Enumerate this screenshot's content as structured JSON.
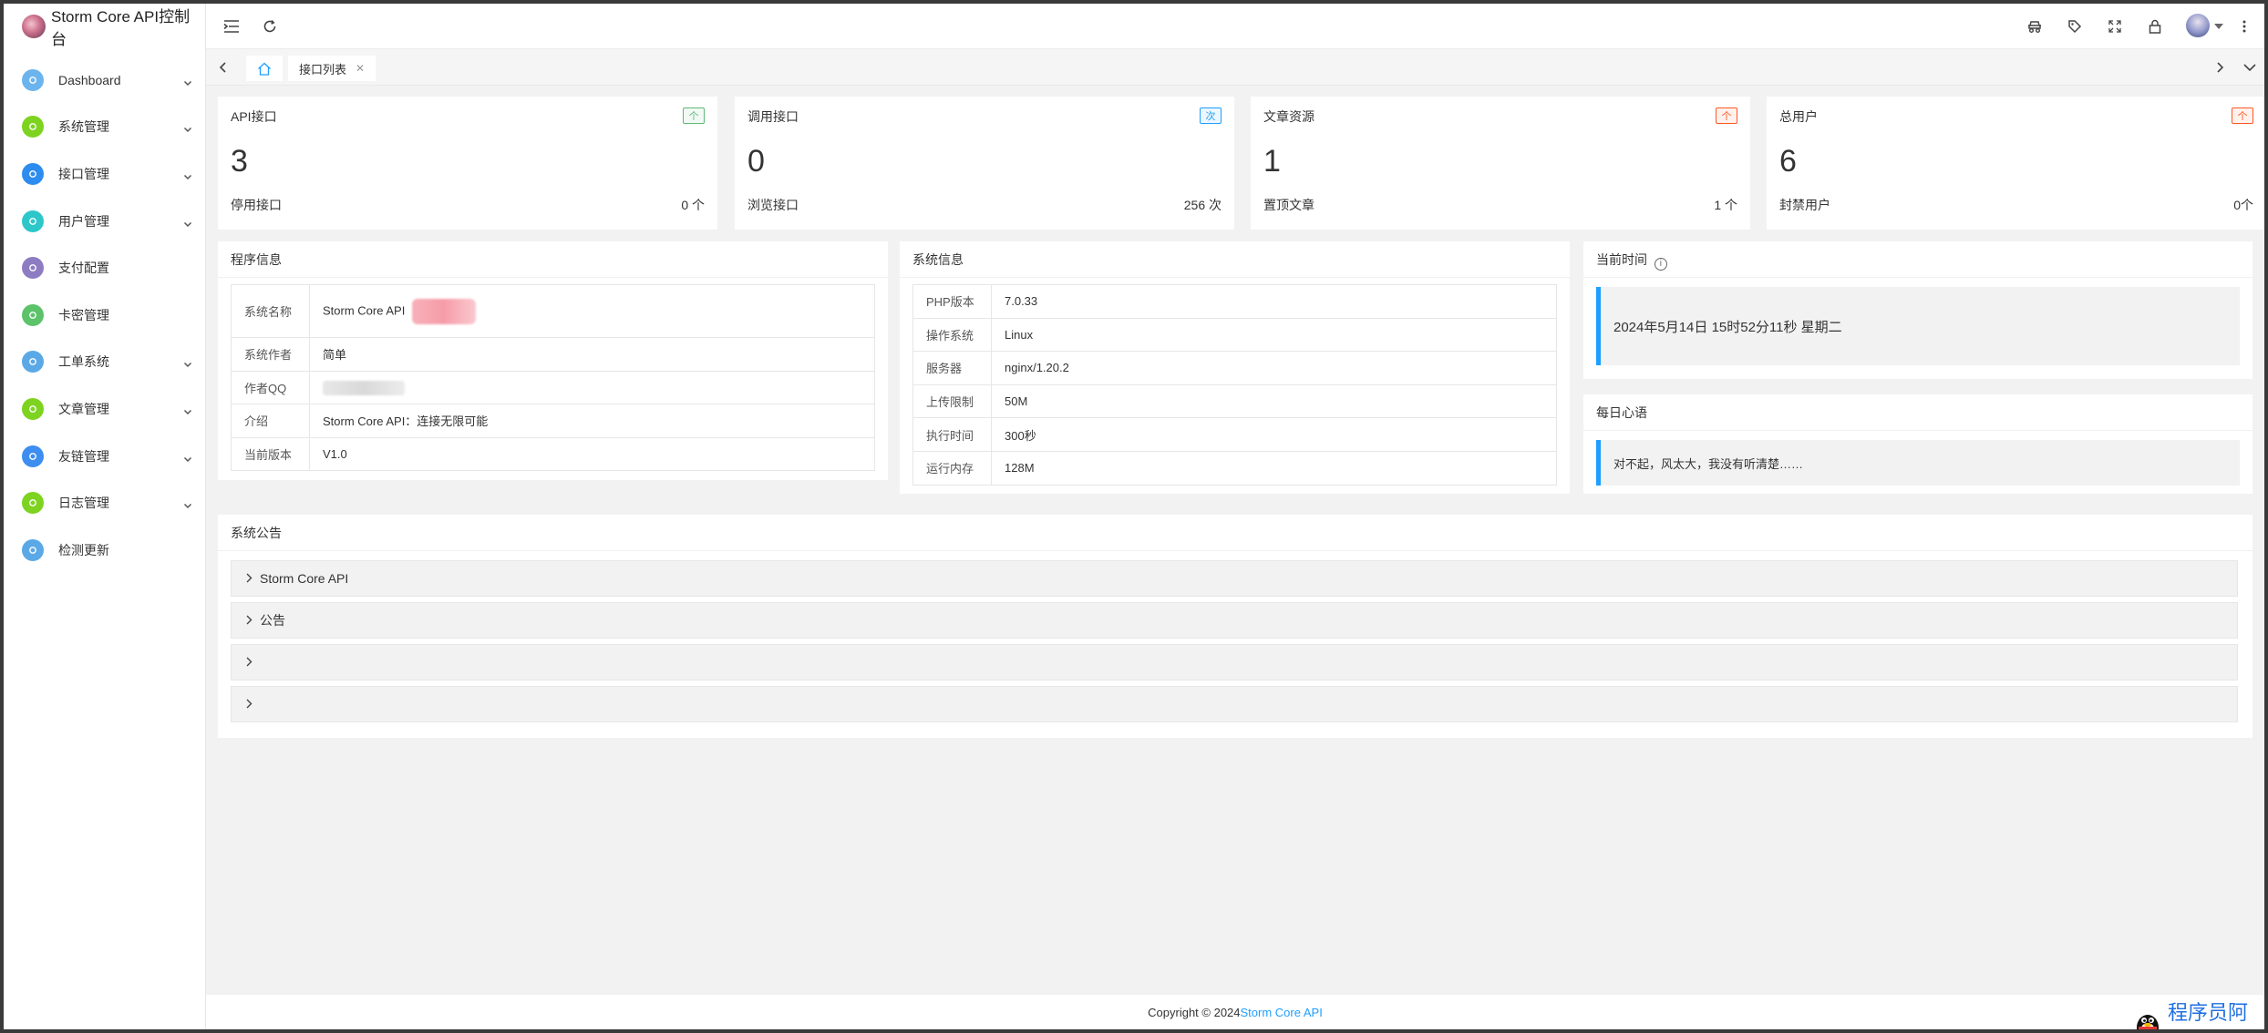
{
  "app": {
    "title": "Storm Core API控制台"
  },
  "sidebar": {
    "items": [
      {
        "label": "Dashboard",
        "icon": "dashboard-icon",
        "color": "#6cb4ee",
        "has_arrow": true
      },
      {
        "label": "系统管理",
        "icon": "gear-icon",
        "color": "#7ed321",
        "has_arrow": true
      },
      {
        "label": "接口管理",
        "icon": "api-icon",
        "color": "#2d8cf0",
        "has_arrow": true
      },
      {
        "label": "用户管理",
        "icon": "user-icon",
        "color": "#2ec7c9",
        "has_arrow": true
      },
      {
        "label": "支付配置",
        "icon": "payment-icon",
        "color": "#8e7cc3",
        "has_arrow": false
      },
      {
        "label": "卡密管理",
        "icon": "card-icon",
        "color": "#5cc36a",
        "has_arrow": false
      },
      {
        "label": "工单系统",
        "icon": "ticket-icon",
        "color": "#5aa9e6",
        "has_arrow": true
      },
      {
        "label": "文章管理",
        "icon": "article-icon",
        "color": "#7ed321",
        "has_arrow": true
      },
      {
        "label": "友链管理",
        "icon": "link-icon",
        "color": "#3d8ef0",
        "has_arrow": true
      },
      {
        "label": "日志管理",
        "icon": "log-icon",
        "color": "#7ed321",
        "has_arrow": true
      },
      {
        "label": "检测更新",
        "icon": "update-icon",
        "color": "#5aa9e6",
        "has_arrow": false
      }
    ]
  },
  "tabs": {
    "active_label": "接口列表"
  },
  "stats": [
    {
      "title": "API接口",
      "badge": "个",
      "badge_color": "#5fb878",
      "value": "3",
      "sub_label": "停用接口",
      "sub_value": "0 个"
    },
    {
      "title": "调用接口",
      "badge": "次",
      "badge_color": "#1e9fff",
      "value": "0",
      "sub_label": "浏览接口",
      "sub_value": "256 次"
    },
    {
      "title": "文章资源",
      "badge": "个",
      "badge_color": "#ff5722",
      "value": "1",
      "sub_label": "置顶文章",
      "sub_value": "1 个"
    },
    {
      "title": "总用户",
      "badge": "个",
      "badge_color": "#ff5722",
      "value": "6",
      "sub_label": "封禁用户",
      "sub_value": "0个"
    }
  ],
  "program_info": {
    "header": "程序信息",
    "rows": [
      {
        "key": "系统名称",
        "value": "Storm Core API"
      },
      {
        "key": "系统作者",
        "value": "简单"
      },
      {
        "key": "作者QQ",
        "value": ""
      },
      {
        "key": "介绍",
        "value": "Storm Core API：连接无限可能"
      },
      {
        "key": "当前版本",
        "value": "V1.0"
      }
    ]
  },
  "system_info": {
    "header": "系统信息",
    "rows": [
      {
        "key": "PHP版本",
        "value": "7.0.33"
      },
      {
        "key": "操作系统",
        "value": "Linux"
      },
      {
        "key": "服务器",
        "value": "nginx/1.20.2"
      },
      {
        "key": "上传限制",
        "value": "50M"
      },
      {
        "key": "执行时间",
        "value": "300秒"
      },
      {
        "key": "运行内存",
        "value": "128M"
      }
    ]
  },
  "current_time": {
    "header": "当前时间",
    "value": "2024年5月14日 15时52分11秒 星期二"
  },
  "daily_quote": {
    "header": "每日心语",
    "value": "对不起，风太大，我没有听清楚……"
  },
  "announcements": {
    "header": "系统公告",
    "items": [
      "Storm Core API",
      "公告",
      "",
      ""
    ]
  },
  "footer": {
    "copyright": "Copyright © 2024",
    "link_text": "Storm Core API"
  },
  "watermark": {
    "text": "程序员阿鑫"
  },
  "colors": {
    "accent": "#1e9fff",
    "green": "#5fb878",
    "red": "#ff5722"
  }
}
